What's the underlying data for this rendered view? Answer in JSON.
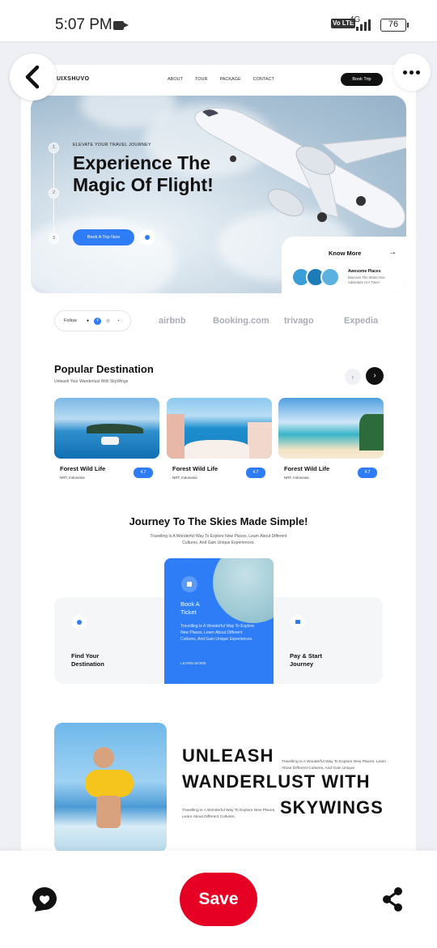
{
  "status_bar": {
    "time": "5:07 PM",
    "volte": "Vo LTE",
    "network": "4G",
    "battery": "76"
  },
  "site": {
    "logo": "UIXSHUVO",
    "nav_links": [
      "ABOUT",
      "TOUR",
      "PACKAGE",
      "CONTACT"
    ],
    "book_trip": "Book Trip",
    "hero": {
      "eyebrow": "ELEVATE YOUR TRAVEL JOURNEY",
      "headline": "Experience The Magic Of Flight!",
      "cta": "Book A Trip Now",
      "steps": [
        "1",
        "2",
        "3"
      ],
      "know_more": "Know More",
      "awesome_places": "Awesome Places",
      "awesome_sub": "Discover The World One Adventure At A Time!"
    },
    "follow_label": "Follow",
    "brands": [
      "airbnb",
      "Booking.com",
      "trivago",
      "Expedia"
    ],
    "popular": {
      "title": "Popular Destination",
      "subtitle": "Unleash Your Wanderlust With SkyWings",
      "cards": [
        {
          "name": "Forest Wild Life",
          "location": "NRT, Indonesia",
          "rating": "4.7"
        },
        {
          "name": "Forest Wild Life",
          "location": "NRT, Indonesia",
          "rating": "4.7"
        },
        {
          "name": "Forest Wild Life",
          "location": "NRT, Indonesia",
          "rating": "4.7"
        }
      ]
    },
    "journey": {
      "title": "Journey To The Skies Made Simple!",
      "subtitle": "Travelling Is A Wonderful Way To Explore New Places, Learn About Different Cultures, And Gain Unique Experiences.",
      "left_label": "Find Your Destination",
      "center_title": "Book A Ticket",
      "center_desc": "Travelling Is A Wonderful Way To Explore New Places, Learn About Different Cultures, And Gain Unique Experiences.",
      "center_more": "LEARN MORE",
      "right_label": "Pay & Start Journey"
    },
    "unleash": {
      "line1": "UNLEASH",
      "line2": "WANDERLUST WITH",
      "line3": "SKYWINGS",
      "side1": "Travelling Is A Wonderful Way To Explore New Places, Learn About Different Cultures, And Gain Unique",
      "side2": "Travelling Is A Wonderful Way To Explore New Places, Learn About Different Cultures,"
    }
  },
  "action_bar": {
    "save": "Save"
  },
  "colors": {
    "accent": "#2f7df6",
    "pinterest_red": "#e60023"
  }
}
